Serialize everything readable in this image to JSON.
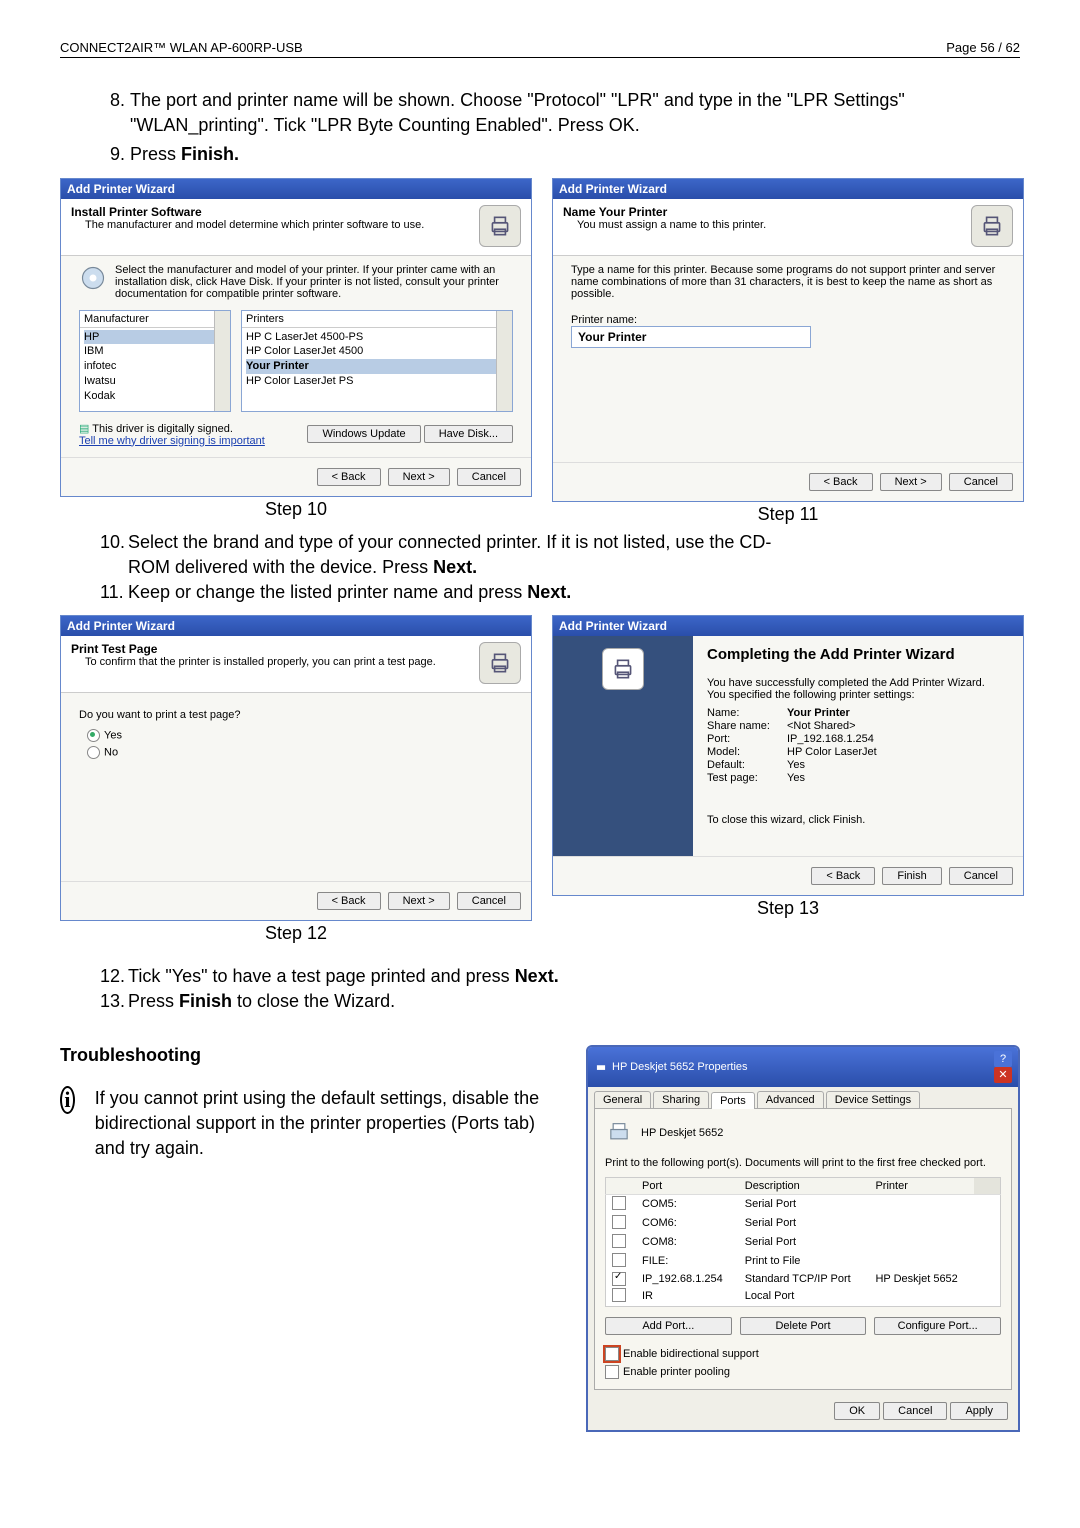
{
  "header": {
    "left": "CONNECT2AIR™ WLAN AP-600RP-USB",
    "right": "Page 56 / 62"
  },
  "intro_list": {
    "item8": "The port and printer name will be shown. Choose \"Protocol\" \"LPR\" and type in the \"LPR Settings\" \"WLAN_printing\". Tick \"LPR Byte Counting Enabled\". Press OK.",
    "item9_prefix": "Press ",
    "item9_bold": "Finish."
  },
  "step10": {
    "dialog_title": "Add Printer Wizard",
    "head_title": "Install Printer Software",
    "head_sub": "The manufacturer and model determine which printer software to use.",
    "help": "Select the manufacturer and model of your printer. If your printer came with an installation disk, click Have Disk. If your printer is not listed, consult your printer documentation for compatible printer software.",
    "manuf_label": "Manufacturer",
    "manuf_items": [
      "HP",
      "IBM",
      "infotec",
      "Iwatsu",
      "Kodak"
    ],
    "printers_label": "Printers",
    "printer_items": [
      "HP C LaserJet 4500-PS",
      "HP Color LaserJet 4500",
      "Your Printer",
      "HP Color LaserJet PS"
    ],
    "signed_text": "This driver is digitally signed.",
    "signed_link": "Tell me why driver signing is important",
    "btn_winupdate": "Windows Update",
    "btn_havedisk": "Have Disk...",
    "btn_back": "< Back",
    "btn_next": "Next >",
    "btn_cancel": "Cancel",
    "caption": "Step 10"
  },
  "step11": {
    "dialog_title": "Add Printer Wizard",
    "head_title": "Name Your Printer",
    "head_sub": "You must assign a name to this printer.",
    "help": "Type a name for this printer. Because some programs do not support printer and server name combinations of more than 31 characters, it is best to keep the name as short as possible.",
    "name_label": "Printer name:",
    "name_value": "Your Printer",
    "btn_back": "< Back",
    "btn_next": "Next >",
    "btn_cancel": "Cancel",
    "caption": "Step 11"
  },
  "after10": {
    "l10a": "Select the brand and type of your connected printer. If it is not listed, use the CD-",
    "l10b": "ROM delivered with the device. Press ",
    "l10bold": "Next.",
    "l11": "Keep or change the listed printer name and press ",
    "l11bold": "Next."
  },
  "step12": {
    "dialog_title": "Add Printer Wizard",
    "head_title": "Print Test Page",
    "head_sub": "To confirm that the printer is installed properly, you can print a test page.",
    "question": "Do you want to print a test page?",
    "opt_yes": "Yes",
    "opt_no": "No",
    "btn_back": "< Back",
    "btn_next": "Next >",
    "btn_cancel": "Cancel",
    "caption": "Step 12"
  },
  "step13": {
    "dialog_title": "Add Printer Wizard",
    "title2": "Completing the Add Printer Wizard",
    "line1": "You have successfully completed the Add Printer Wizard.",
    "line2": "You specified the following printer settings:",
    "kv": {
      "Name": "Your Printer",
      "Share_name": "<Not Shared>",
      "Port": "IP_192.168.1.254",
      "Model": "HP Color LaserJet",
      "Default": "Yes",
      "Test_page": "Yes"
    },
    "close_hint": "To close this wizard, click Finish.",
    "btn_back": "< Back",
    "btn_finish": "Finish",
    "btn_cancel": "Cancel",
    "caption": "Step 13"
  },
  "after12": {
    "l12": "Tick \"Yes\" to have a test page printed and press ",
    "l12bold": "Next.",
    "l13a": "Press ",
    "l13bold": "Finish",
    "l13b": " to close the Wizard."
  },
  "troubleshoot": {
    "heading": "Troubleshooting",
    "info": "If you cannot print using the default settings, disable the bidirectional support in the printer properties (Ports tab) and try again."
  },
  "props": {
    "title": "HP Deskjet 5652 Properties",
    "tabs": [
      "General",
      "Sharing",
      "Ports",
      "Advanced",
      "Device Settings"
    ],
    "printer_name": "HP Deskjet 5652",
    "desc": "Print to the following port(s). Documents will print to the first free checked port.",
    "cols": [
      "Port",
      "Description",
      "Printer"
    ],
    "rows": [
      {
        "chk": false,
        "port": "COM5:",
        "desc": "Serial Port",
        "printer": ""
      },
      {
        "chk": false,
        "port": "COM6:",
        "desc": "Serial Port",
        "printer": ""
      },
      {
        "chk": false,
        "port": "COM8:",
        "desc": "Serial Port",
        "printer": ""
      },
      {
        "chk": false,
        "port": "FILE:",
        "desc": "Print to File",
        "printer": ""
      },
      {
        "chk": true,
        "port": "IP_192.68.1.254",
        "desc": "Standard TCP/IP Port",
        "printer": "HP Deskjet 5652"
      },
      {
        "chk": false,
        "port": "IR",
        "desc": "Local Port",
        "printer": ""
      }
    ],
    "btn_add": "Add Port...",
    "btn_del": "Delete Port",
    "btn_cfg": "Configure Port...",
    "chk_bidi": "Enable bidirectional support",
    "chk_pool": "Enable printer pooling",
    "btn_ok": "OK",
    "btn_cancel": "Cancel",
    "btn_apply": "Apply"
  }
}
